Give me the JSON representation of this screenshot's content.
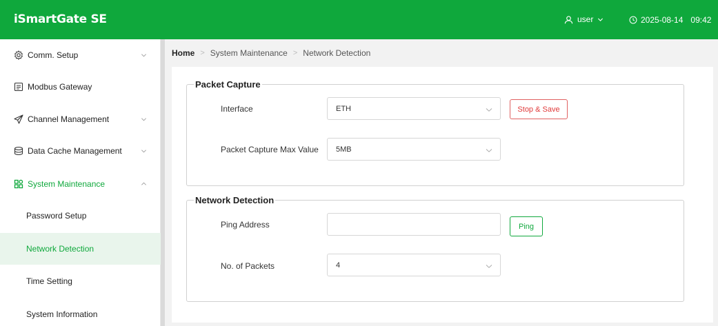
{
  "app": {
    "title": "iSmartGate SE",
    "user_label": "user",
    "date": "2025-08-14",
    "time": "09:42"
  },
  "colors": {
    "brand": "#0fa83c",
    "danger": "#e03a3a",
    "selected_bg": "#e9f5ec"
  },
  "sidebar": {
    "items": [
      {
        "label": "Comm. Setup",
        "icon": "gear-icon",
        "expandable": true
      },
      {
        "label": "Modbus Gateway",
        "icon": "gateway-icon",
        "expandable": false
      },
      {
        "label": "Channel Management",
        "icon": "send-icon",
        "expandable": true
      },
      {
        "label": "Data Cache Management",
        "icon": "database-icon",
        "expandable": true
      },
      {
        "label": "System Maintenance",
        "icon": "grid-icon",
        "expandable": true,
        "expanded": true
      }
    ],
    "sub_items": [
      {
        "label": "Password Setup"
      },
      {
        "label": "Network Detection",
        "selected": true
      },
      {
        "label": "Time Setting"
      },
      {
        "label": "System Information"
      }
    ]
  },
  "breadcrumb": {
    "home": "Home",
    "level1": "System Maintenance",
    "level2": "Network Detection"
  },
  "packet_capture": {
    "legend": "Packet Capture",
    "interface_label": "Interface",
    "interface_value": "ETH",
    "stop_button": "Stop & Save",
    "max_label": "Packet Capture Max Value",
    "max_value": "5MB"
  },
  "network_detection": {
    "legend": "Network Detection",
    "ping_label": "Ping Address",
    "ping_value": "",
    "ping_button": "Ping",
    "packets_label": "No. of Packets",
    "packets_value": "4"
  }
}
